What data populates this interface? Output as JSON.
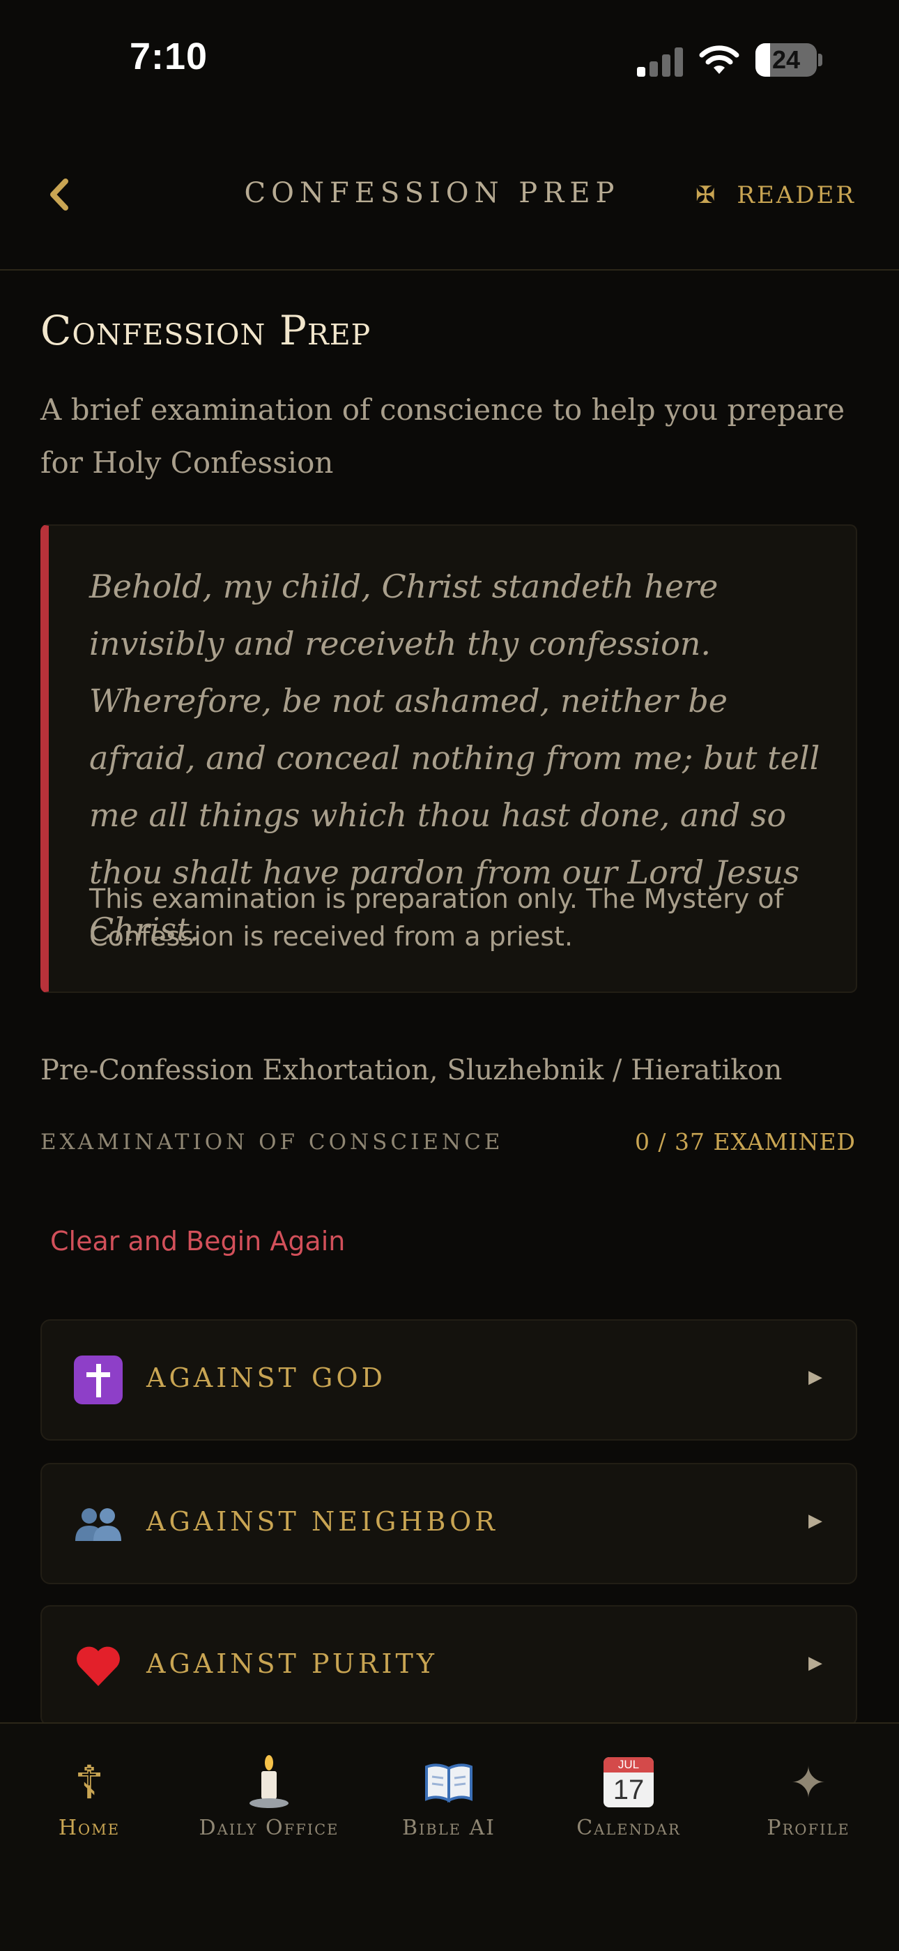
{
  "status_bar": {
    "time": "7:10",
    "battery": "24",
    "battery_level_percent": 24
  },
  "header": {
    "back_icon": "chevron-left-icon",
    "title": "CONFESSION PREP",
    "reader_icon": "cross-pattee-icon",
    "reader_label": "READER",
    "reader_glyph": "✠"
  },
  "page": {
    "title": "Confession Prep",
    "subtitle": "A brief examination of conscience to help you prepare for Holy Confession"
  },
  "quote": {
    "text": "Behold, my child, Christ standeth here invisibly and receiveth thy confession. Wherefore, be not ashamed, neither be afraid, and conceal nothing from me; but tell me all things which thou hast done, and so thou shalt have pardon from our Lord Jesus Christ.",
    "note": "This examination is preparation only. The Mystery of Confession is received from a priest.",
    "accent_color": "#b8323a"
  },
  "source": "Pre-Confession Exhortation, Sluzhebnik / Hieratikon",
  "examination": {
    "label": "EXAMINATION OF CONSCIENCE",
    "count": "0 / 37 EXAMINED",
    "clear_label": "Clear and Begin Again"
  },
  "categories": [
    {
      "label": "AGAINST GOD",
      "icon": "latin-cross-icon",
      "arrow": "▶"
    },
    {
      "label": "AGAINST NEIGHBOR",
      "icon": "people-icon",
      "arrow": "▶"
    },
    {
      "label": "AGAINST PURITY",
      "icon": "heart-icon",
      "arrow": "▶"
    }
  ],
  "tabs": [
    {
      "label": "Home",
      "icon": "orthodox-cross-icon",
      "glyph": "☦",
      "active": true
    },
    {
      "label": "Daily Office",
      "icon": "candle-icon",
      "active": false
    },
    {
      "label": "Bible AI",
      "icon": "open-book-icon",
      "active": false
    },
    {
      "label": "Calendar",
      "icon": "calendar-icon",
      "month": "JUL",
      "day": "17",
      "active": false
    },
    {
      "label": "Profile",
      "icon": "sparkle-star-icon",
      "glyph": "✦",
      "active": false
    }
  ],
  "colors": {
    "background": "#0b0a08",
    "gold": "#c9a553",
    "muted_text": "#a99f8c",
    "danger": "#d2505a"
  }
}
